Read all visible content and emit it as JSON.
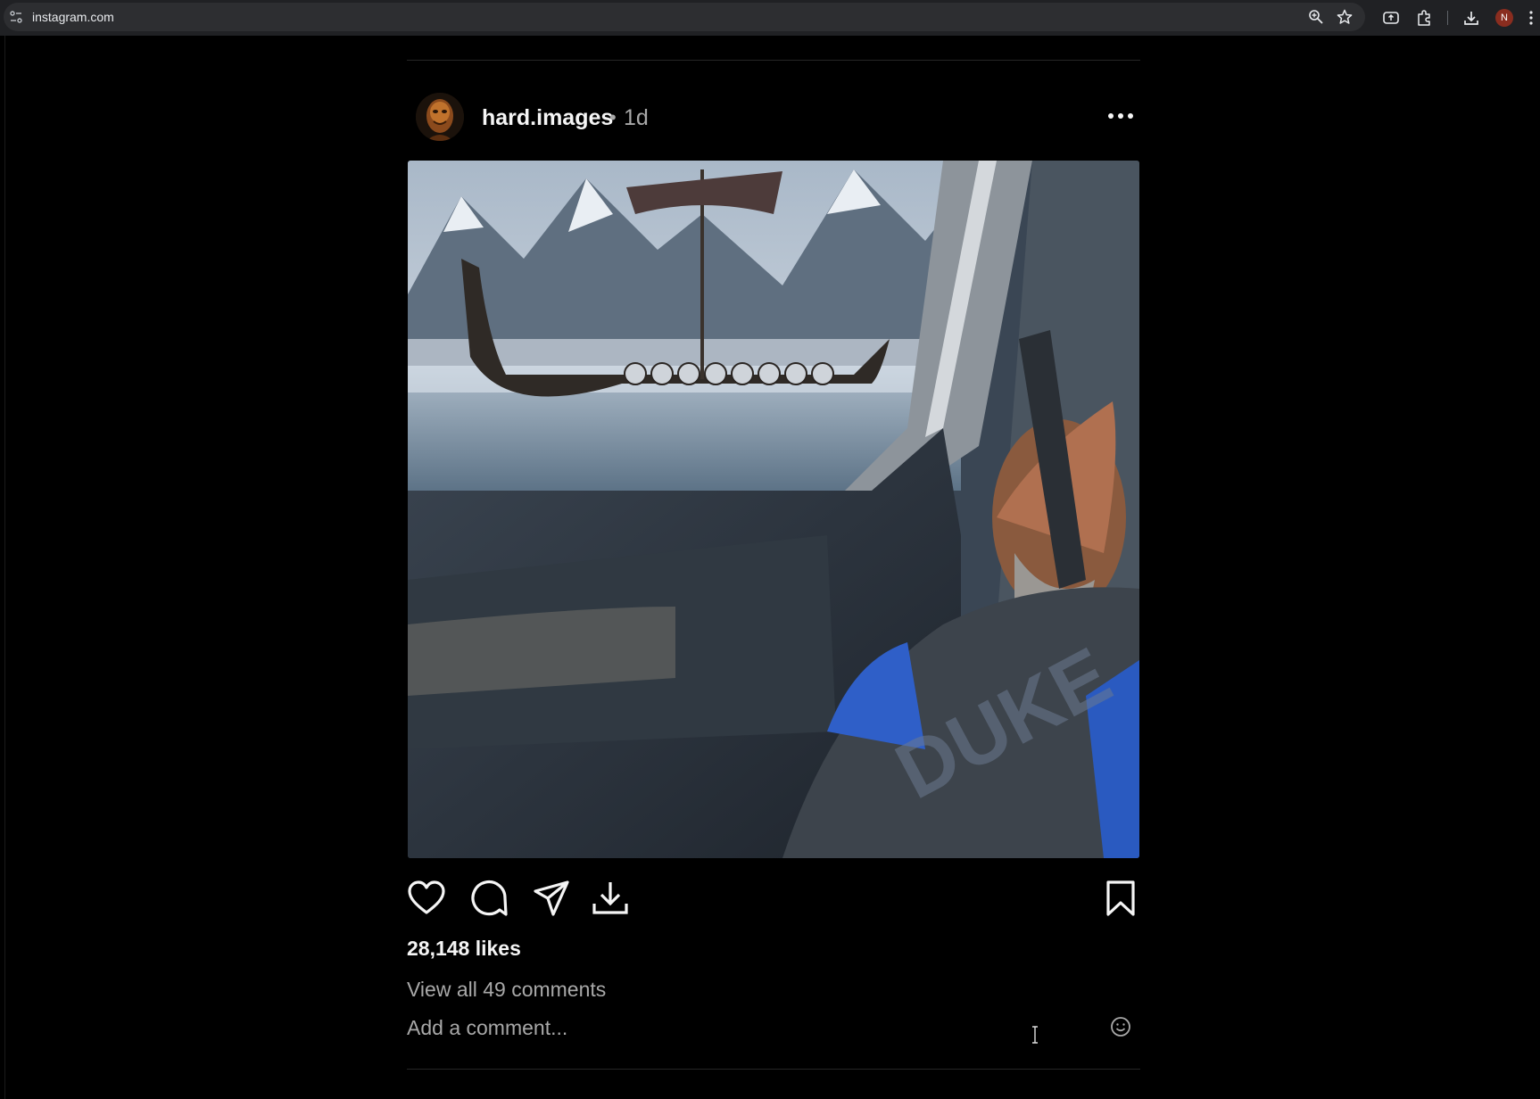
{
  "browser": {
    "url": "instagram.com",
    "profile_initial": "N",
    "icons": [
      "site-info-icon",
      "zoom-icon",
      "bookmark-star-icon",
      "screen-share-icon",
      "extensions-icon",
      "download-icon",
      "more-vert-icon"
    ]
  },
  "post": {
    "username": "hard.images",
    "separator": "•",
    "time": "1d",
    "likes": "28,148 likes",
    "view_comments": "View all 49 comments",
    "comment_placeholder": "Add a comment...",
    "actions": [
      "heart-icon",
      "comment-icon",
      "share-icon",
      "download-icon",
      "save-icon"
    ]
  }
}
